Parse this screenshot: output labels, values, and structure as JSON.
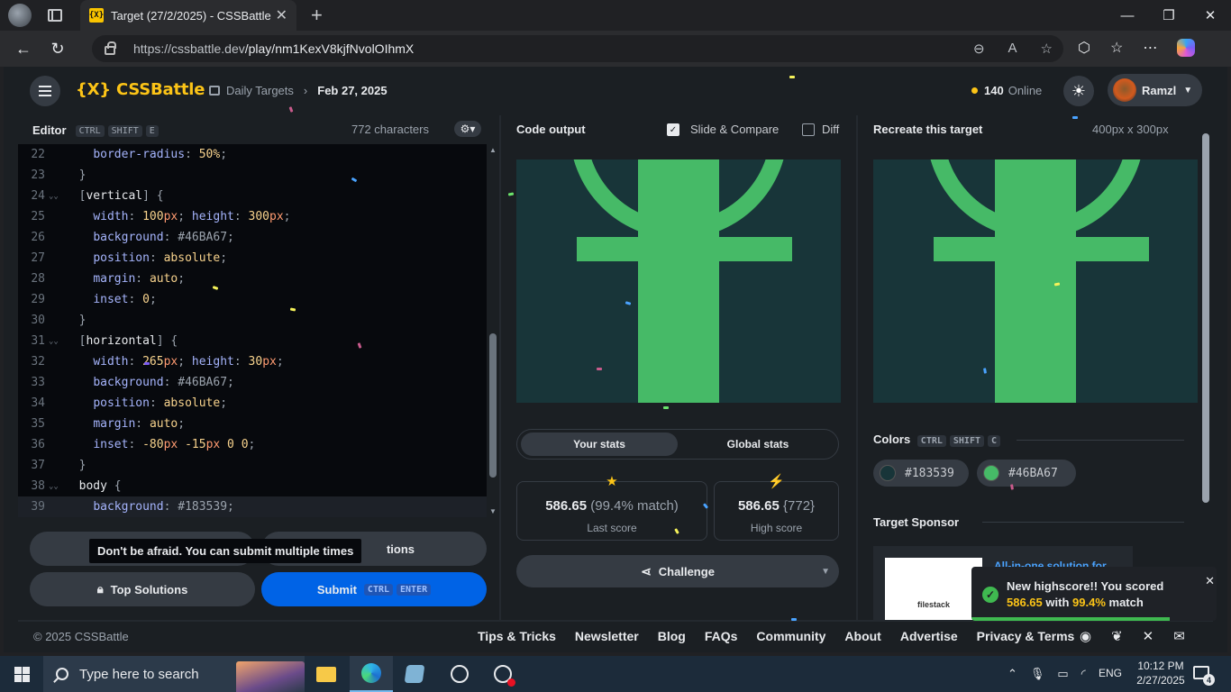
{
  "browser": {
    "tab_favicon": "{X}",
    "tab_title": "Target (27/2/2025) - CSSBattle",
    "url_host": "https://cssbattle.dev",
    "url_path": "/play/nm1KexV8kjfNvolOIhmX"
  },
  "header": {
    "logo": "{X} CSSBattle",
    "breadcrumb_root": "Daily Targets",
    "breadcrumb_current": "Feb 27, 2025",
    "online_count": "140",
    "online_label": "Online",
    "username": "Ramzl"
  },
  "editor": {
    "title": "Editor",
    "shortcut": [
      "CTRL",
      "SHIFT",
      "E"
    ],
    "char_count": "772 characters",
    "lines": [
      {
        "n": "22",
        "fold": false,
        "tokens": [
          [
            "    ",
            ""
          ],
          [
            "border-radius",
            "prop"
          ],
          [
            ": ",
            "punc"
          ],
          [
            "50%",
            "val"
          ],
          [
            ";",
            "punc"
          ]
        ]
      },
      {
        "n": "23",
        "fold": false,
        "tokens": [
          [
            "  }",
            "punc"
          ]
        ]
      },
      {
        "n": "24",
        "fold": true,
        "tokens": [
          [
            "  [",
            "punc"
          ],
          [
            "vertical",
            "sel"
          ],
          [
            "] {",
            "punc"
          ]
        ]
      },
      {
        "n": "25",
        "fold": false,
        "tokens": [
          [
            "    ",
            ""
          ],
          [
            "width",
            "prop"
          ],
          [
            ": ",
            "punc"
          ],
          [
            "100",
            "num"
          ],
          [
            "px",
            "unit"
          ],
          [
            "; ",
            "punc"
          ],
          [
            "height",
            "prop"
          ],
          [
            ": ",
            "punc"
          ],
          [
            "300",
            "num"
          ],
          [
            "px",
            "unit"
          ],
          [
            ";",
            "punc"
          ]
        ]
      },
      {
        "n": "26",
        "fold": false,
        "tokens": [
          [
            "    ",
            ""
          ],
          [
            "background",
            "prop"
          ],
          [
            ": ",
            "punc"
          ],
          [
            "#46BA67",
            "hex"
          ],
          [
            ";",
            "punc"
          ]
        ]
      },
      {
        "n": "27",
        "fold": false,
        "tokens": [
          [
            "    ",
            ""
          ],
          [
            "position",
            "prop"
          ],
          [
            ": ",
            "punc"
          ],
          [
            "absolute",
            "val"
          ],
          [
            ";",
            "punc"
          ]
        ]
      },
      {
        "n": "28",
        "fold": false,
        "tokens": [
          [
            "    ",
            ""
          ],
          [
            "margin",
            "prop"
          ],
          [
            ": ",
            "punc"
          ],
          [
            "auto",
            "val"
          ],
          [
            ";",
            "punc"
          ]
        ]
      },
      {
        "n": "29",
        "fold": false,
        "tokens": [
          [
            "    ",
            ""
          ],
          [
            "inset",
            "prop"
          ],
          [
            ": ",
            "punc"
          ],
          [
            "0",
            "num"
          ],
          [
            ";",
            "punc"
          ]
        ]
      },
      {
        "n": "30",
        "fold": false,
        "tokens": [
          [
            "  }",
            "punc"
          ]
        ]
      },
      {
        "n": "31",
        "fold": true,
        "tokens": [
          [
            "  [",
            "punc"
          ],
          [
            "horizontal",
            "sel"
          ],
          [
            "] {",
            "punc"
          ]
        ]
      },
      {
        "n": "32",
        "fold": false,
        "tokens": [
          [
            "    ",
            ""
          ],
          [
            "width",
            "prop"
          ],
          [
            ": ",
            "punc"
          ],
          [
            "265",
            "num"
          ],
          [
            "px",
            "unit"
          ],
          [
            "; ",
            "punc"
          ],
          [
            "height",
            "prop"
          ],
          [
            ": ",
            "punc"
          ],
          [
            "30",
            "num"
          ],
          [
            "px",
            "unit"
          ],
          [
            ";",
            "punc"
          ]
        ]
      },
      {
        "n": "33",
        "fold": false,
        "tokens": [
          [
            "    ",
            ""
          ],
          [
            "background",
            "prop"
          ],
          [
            ": ",
            "punc"
          ],
          [
            "#46BA67",
            "hex"
          ],
          [
            ";",
            "punc"
          ]
        ]
      },
      {
        "n": "34",
        "fold": false,
        "tokens": [
          [
            "    ",
            ""
          ],
          [
            "position",
            "prop"
          ],
          [
            ": ",
            "punc"
          ],
          [
            "absolute",
            "val"
          ],
          [
            ";",
            "punc"
          ]
        ]
      },
      {
        "n": "35",
        "fold": false,
        "tokens": [
          [
            "    ",
            ""
          ],
          [
            "margin",
            "prop"
          ],
          [
            ": ",
            "punc"
          ],
          [
            "auto",
            "val"
          ],
          [
            ";",
            "punc"
          ]
        ]
      },
      {
        "n": "36",
        "fold": false,
        "tokens": [
          [
            "    ",
            ""
          ],
          [
            "inset",
            "prop"
          ],
          [
            ": ",
            "punc"
          ],
          [
            "-80",
            "num"
          ],
          [
            "px ",
            "unit"
          ],
          [
            "-15",
            "num"
          ],
          [
            "px ",
            "unit"
          ],
          [
            "0 0",
            "num"
          ],
          [
            ";",
            "punc"
          ]
        ]
      },
      {
        "n": "37",
        "fold": false,
        "tokens": [
          [
            "  }",
            "punc"
          ]
        ]
      },
      {
        "n": "38",
        "fold": true,
        "tokens": [
          [
            "  ",
            ""
          ],
          [
            "body",
            "sel"
          ],
          [
            " {",
            "punc"
          ]
        ]
      },
      {
        "n": "39",
        "fold": false,
        "active": true,
        "tokens": [
          [
            "    ",
            ""
          ],
          [
            "background",
            "prop"
          ],
          [
            ": ",
            "punc"
          ],
          [
            "#183539",
            "hex"
          ],
          [
            ";",
            "punc"
          ]
        ]
      }
    ],
    "tooltip": "Don't be afraid. You can submit multiple times",
    "hidden_button": "tions",
    "top_solutions": "Top Solutions",
    "submit": "Submit",
    "submit_keys": [
      "CTRL",
      "ENTER"
    ]
  },
  "output": {
    "title": "Code output",
    "slide_compare": "Slide & Compare",
    "slide_checked": true,
    "diff": "Diff",
    "diff_checked": false,
    "tabs": [
      "Your stats",
      "Global stats"
    ],
    "last_score": "586.65",
    "last_match": "(99.4% match)",
    "last_label": "Last score",
    "high_score": "586.65",
    "high_chars": "{772}",
    "high_label": "High score",
    "challenge": "Challenge"
  },
  "target": {
    "title": "Recreate this target",
    "size": "400px x 300px",
    "colors_title": "Colors",
    "colors_keys": [
      "CTRL",
      "SHIFT",
      "C"
    ],
    "colors": [
      "#183539",
      "#46BA67"
    ],
    "sponsor_title": "Target Sponsor",
    "sponsor_text": "All-in-one solution for",
    "sponsor_logo": "filestack"
  },
  "footer": {
    "copyright": "© 2025 CSSBattle",
    "links": [
      "Tips & Tricks",
      "Newsletter",
      "Blog",
      "FAQs",
      "Community",
      "About",
      "Advertise",
      "Privacy & Terms"
    ]
  },
  "toast": {
    "line1": "New highscore!! You scored",
    "score": "586.65",
    "with": "with",
    "match": "99.4%",
    "match_suffix": "match",
    "progress": 0.81
  },
  "taskbar": {
    "search_placeholder": "Type here to search",
    "lang": "ENG",
    "time": "10:12 PM",
    "date": "2/27/2025",
    "notifications": "4"
  },
  "colors": {
    "brand": "#fcc417",
    "target_bg": "#183539",
    "target_fg": "#46BA67",
    "submit": "#0063e6"
  }
}
